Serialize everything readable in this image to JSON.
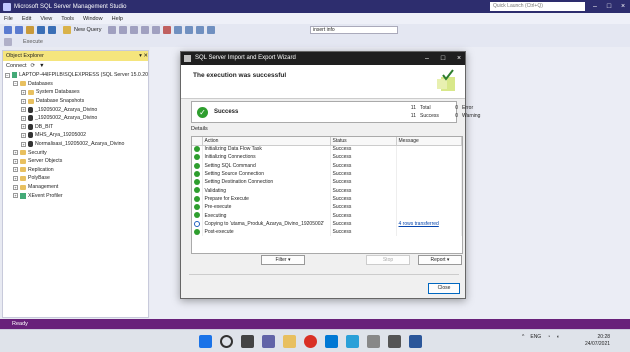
{
  "app": {
    "title": "Microsoft SQL Server Management Studio",
    "quick_launch_placeholder": "Quick Launch (Ctrl+Q)",
    "menus": [
      "File",
      "Edit",
      "View",
      "Tools",
      "Window",
      "Help"
    ],
    "toolbar": {
      "new_query": "New Query",
      "combo_value": "insert info",
      "execute": "Execute"
    },
    "status": "Ready"
  },
  "object_explorer": {
    "title": "Object Explorer",
    "connect": "Connect",
    "nodes": [
      {
        "label": "LAPTOP-44IFPILB\\SQLEXPRESS (SQL Server 15.0.20",
        "level": 0,
        "icon": "server"
      },
      {
        "label": "Databases",
        "level": 1,
        "icon": "folder"
      },
      {
        "label": "System Databases",
        "level": 2,
        "icon": "folder"
      },
      {
        "label": "Database Snapshots",
        "level": 2,
        "icon": "folder"
      },
      {
        "label": "_19205002_Azarya_Divino",
        "level": 2,
        "icon": "db"
      },
      {
        "label": "_19205002_Azarya_Divino",
        "level": 2,
        "icon": "db"
      },
      {
        "label": "DB_BIT",
        "level": 2,
        "icon": "db"
      },
      {
        "label": "MHS_Arya_19205002",
        "level": 2,
        "icon": "db"
      },
      {
        "label": "Normalisasi_19205002_Azarya_Divino",
        "level": 2,
        "icon": "db"
      },
      {
        "label": "Security",
        "level": 1,
        "icon": "folder"
      },
      {
        "label": "Server Objects",
        "level": 1,
        "icon": "folder"
      },
      {
        "label": "Replication",
        "level": 1,
        "icon": "folder"
      },
      {
        "label": "PolyBase",
        "level": 1,
        "icon": "folder"
      },
      {
        "label": "Management",
        "level": 1,
        "icon": "folder"
      },
      {
        "label": "XEvent Profiler",
        "level": 1,
        "icon": "profiler"
      }
    ]
  },
  "wizard": {
    "title": "SQL Server Import and Export Wizard",
    "heading": "The execution was successful",
    "status": "Success",
    "counts": [
      {
        "n": "11",
        "label": "Total",
        "n2": "0",
        "label2": "Error"
      },
      {
        "n": "11",
        "label": "Success",
        "n2": "0",
        "label2": "Warning"
      }
    ],
    "details_label": "Details",
    "columns": [
      "Action",
      "Status",
      "Message"
    ],
    "rows": [
      {
        "icon": "success",
        "action": "Initializing Data Flow Task",
        "status": "Success",
        "message": ""
      },
      {
        "icon": "success",
        "action": "Initializing Connections",
        "status": "Success",
        "message": ""
      },
      {
        "icon": "success",
        "action": "Setting SQL Command",
        "status": "Success",
        "message": ""
      },
      {
        "icon": "success",
        "action": "Setting Source Connection",
        "status": "Success",
        "message": ""
      },
      {
        "icon": "success",
        "action": "Setting Destination Connection",
        "status": "Success",
        "message": ""
      },
      {
        "icon": "success",
        "action": "Validating",
        "status": "Success",
        "message": ""
      },
      {
        "icon": "success",
        "action": "Prepare for Execute",
        "status": "Success",
        "message": ""
      },
      {
        "icon": "success",
        "action": "Pre-execute",
        "status": "Success",
        "message": ""
      },
      {
        "icon": "success",
        "action": "Executing",
        "status": "Success",
        "message": ""
      },
      {
        "icon": "info",
        "action": "Copying to 'utama_Produk_Azarya_Divino_19205002'",
        "status": "Success",
        "message": "4 rows transferred"
      },
      {
        "icon": "success",
        "action": "Post-execute",
        "status": "Success",
        "message": ""
      }
    ],
    "buttons": {
      "filter": "Filter",
      "stop": "Stop",
      "report": "Report",
      "close": "Close"
    }
  },
  "taskbar": {
    "tray_lang": "ENG",
    "time": "20:28",
    "date": "24/07/2021"
  }
}
